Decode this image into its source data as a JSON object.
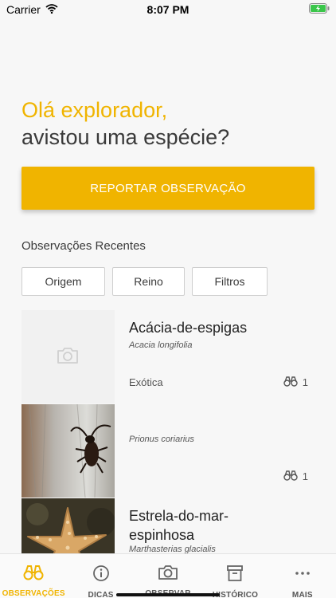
{
  "status_bar": {
    "carrier": "Carrier",
    "time": "8:07 PM"
  },
  "greeting": {
    "line1": "Olá explorador,",
    "line2": "avistou uma espécie?"
  },
  "report_button": {
    "label": "REPORTAR OBSERVAÇÃO"
  },
  "recent": {
    "title": "Observações Recentes",
    "filters": [
      "Origem",
      "Reino",
      "Filtros"
    ],
    "items": [
      {
        "name": "Acácia-de-espigas",
        "scientific": "Acacia longifolia",
        "origin": "Exótica",
        "count": "1",
        "image": "camera-placeholder-icon"
      },
      {
        "name": "",
        "scientific": "Prionus coriarius",
        "origin": "",
        "count": "1",
        "image": "beetle-photo"
      },
      {
        "name": "Estrela-do-mar-espinhosa",
        "scientific": "Marthasterias glacialis",
        "origin": "",
        "count": "",
        "image": "starfish-photo"
      }
    ]
  },
  "tabbar": {
    "tabs": [
      {
        "label": "OBSERVAÇÕES",
        "icon": "binoculars-icon",
        "active": true
      },
      {
        "label": "DICAS",
        "icon": "info-icon",
        "active": false
      },
      {
        "label": "OBSERVAR",
        "icon": "camera-icon",
        "active": false
      },
      {
        "label": "HISTÓRICO",
        "icon": "archive-icon",
        "active": false
      },
      {
        "label": "MAIS",
        "icon": "more-icon",
        "active": false
      }
    ]
  },
  "colors": {
    "accent": "#f0b400",
    "text": "#3a3a3a",
    "background": "#f7f7f7"
  }
}
